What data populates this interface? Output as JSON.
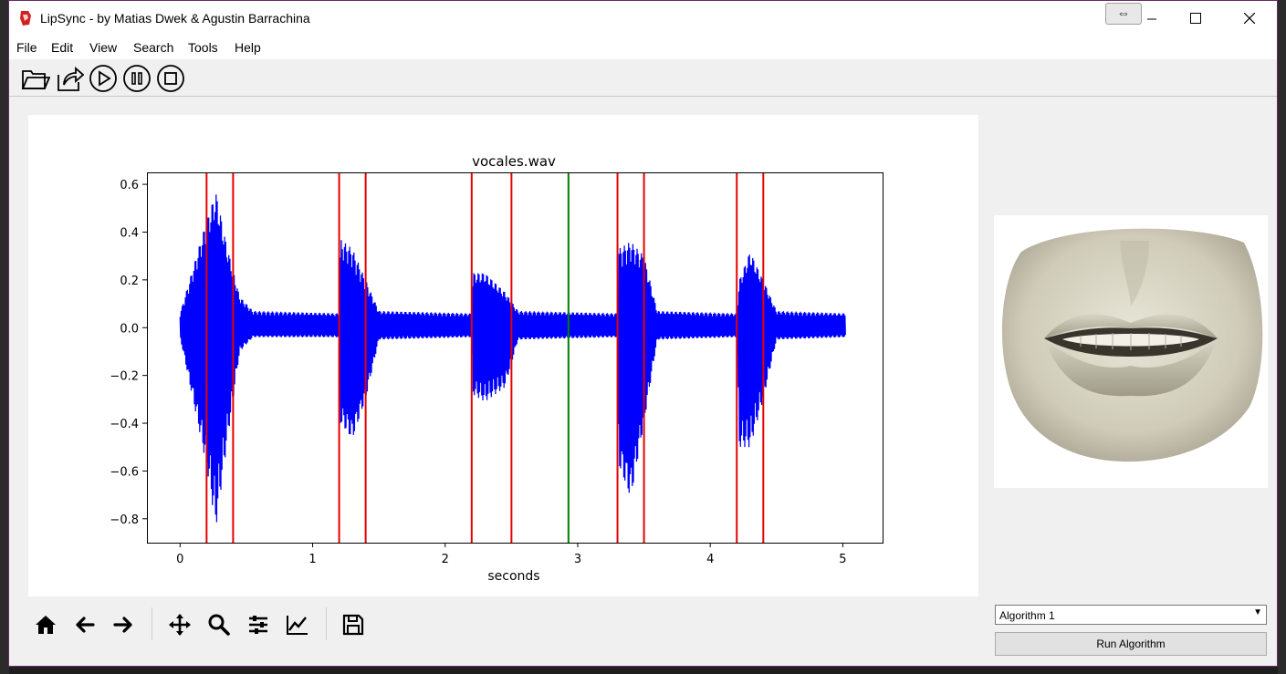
{
  "window": {
    "title": "LipSync - by Matias Dwek & Agustin Barrachina",
    "resize_hint": "⇔"
  },
  "menu": [
    "File",
    "Edit",
    "View",
    "Search",
    "Tools",
    "Help"
  ],
  "toolbar": {
    "icons": [
      "open-folder-icon",
      "export-icon",
      "play-icon",
      "pause-icon",
      "stop-icon"
    ]
  },
  "chart_data": {
    "type": "line",
    "title": "vocales.wav",
    "xlabel": "seconds",
    "ylabel": "",
    "xlim": [
      -0.25,
      5.3
    ],
    "ylim": [
      -0.9,
      0.65
    ],
    "xticks": [
      0,
      1,
      2,
      3,
      4,
      5
    ],
    "yticks": [
      0.6,
      0.4,
      0.2,
      0.0,
      -0.2,
      -0.4,
      -0.6,
      -0.8
    ],
    "ytick_labels": [
      "0.6",
      "0.4",
      "0.2",
      "0.0",
      "−0.2",
      "−0.4",
      "−0.6",
      "−0.8"
    ],
    "series_color": "#0000ff",
    "series": [
      {
        "values": [
          [
            0.0,
            0.06,
            -0.04
          ],
          [
            0.2,
            0.45,
            -0.58
          ],
          [
            0.27,
            0.57,
            -0.84
          ],
          [
            0.35,
            0.35,
            -0.5
          ],
          [
            0.45,
            0.13,
            -0.1
          ],
          [
            0.55,
            0.07,
            -0.04
          ],
          [
            1.2,
            0.06,
            -0.04
          ],
          [
            1.21,
            0.37,
            -0.4
          ],
          [
            1.3,
            0.33,
            -0.47
          ],
          [
            1.4,
            0.2,
            -0.3
          ],
          [
            1.5,
            0.07,
            -0.05
          ],
          [
            2.2,
            0.06,
            -0.04
          ],
          [
            2.21,
            0.23,
            -0.28
          ],
          [
            2.3,
            0.23,
            -0.31
          ],
          [
            2.45,
            0.15,
            -0.25
          ],
          [
            2.55,
            0.07,
            -0.05
          ],
          [
            3.3,
            0.06,
            -0.04
          ],
          [
            3.31,
            0.33,
            -0.58
          ],
          [
            3.4,
            0.36,
            -0.72
          ],
          [
            3.5,
            0.3,
            -0.4
          ],
          [
            3.6,
            0.07,
            -0.05
          ],
          [
            4.2,
            0.06,
            -0.04
          ],
          [
            4.22,
            0.2,
            -0.5
          ],
          [
            4.3,
            0.32,
            -0.5
          ],
          [
            4.4,
            0.2,
            -0.3
          ],
          [
            4.5,
            0.07,
            -0.05
          ],
          [
            5.02,
            0.06,
            -0.04
          ]
        ]
      }
    ],
    "markers_red": [
      0.2,
      0.4,
      1.2,
      1.4,
      2.2,
      2.5,
      3.3,
      3.5,
      4.2,
      4.4
    ],
    "marker_green": 2.93,
    "marker_colors": {
      "red": "#e60000",
      "green": "#008000"
    },
    "grid": false
  },
  "mpl_toolbar": {
    "icons": [
      "home-icon",
      "back-icon",
      "forward-icon",
      "pan-icon",
      "zoom-icon",
      "configure-subplots-icon",
      "edit-axis-icon",
      "save-icon"
    ]
  },
  "controls": {
    "algorithm_selected": "Algorithm 1",
    "run_label": "Run Algorithm"
  }
}
